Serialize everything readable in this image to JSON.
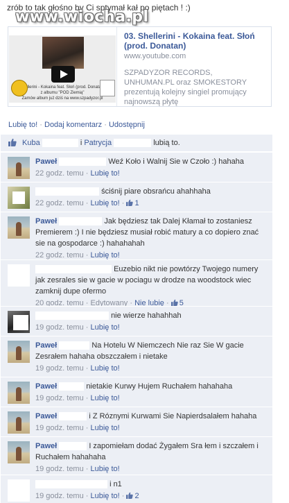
{
  "post": {
    "text": "zrób to tak głośno by Ci sptymał kał po piętach ! :)",
    "watermark": "www.wiocha.pl"
  },
  "attachment": {
    "title": "03. Shellerini - Kokaina feat. Słoń (prod. Donatan)",
    "url": "www.youtube.com",
    "description": "SZPADYZOR RECORDS, UNHUMAN.PL oraz SMOKESTORY prezentują kolejny singiel promujący najnowszą płytę",
    "thumb_caption_1": "Shellerini - Kokaina feat. Słoń (prod. Donatan)",
    "thumb_caption_2": "z albumu \"POD Ziemią\"",
    "thumb_caption_3": "Zamów album już dziś na www.szpadyzor.pl"
  },
  "actions": {
    "like": "Lubię to!",
    "comment": "Dodaj komentarz",
    "share": "Udostępnij",
    "separator": "·"
  },
  "likes": {
    "name1": "Kuba",
    "conj": "i",
    "name2": "Patrycja",
    "suffix": "lubią to."
  },
  "comments": [
    {
      "author": "Paweł",
      "text": "Weź Koło i Walnij Sie w Czoło :) hahaha",
      "time": "22 godz. temu",
      "like": "Lubię to!",
      "likes": ""
    },
    {
      "author": "",
      "text": "ściśnij piare obsrańcu ahahhaha",
      "time": "22 godz. temu",
      "like": "Lubię to!",
      "likes": "1"
    },
    {
      "author": "Paweł",
      "text": "Jak będziesz tak Dalej Kłamał to zostaniesz Premierem :) I nie będziesz musiał robić matury a co dopiero znać sie na gospodarce :) hahahahah",
      "time": "22 godz. temu",
      "like": "Lubię to!",
      "likes": ""
    },
    {
      "author": "",
      "text": "Euzebio nikt nie powtórzy Twojego numery jak zesrales sie w gacie w pociagu w drodze na woodstock wiec zamknij dupe ofermo",
      "time": "20 godz. temu",
      "edited": "Edytowany",
      "like": "Nie lubię",
      "likes": "5"
    },
    {
      "author": "",
      "text": "nie wierze hahahhah",
      "time": "19 godz. temu",
      "like": "Lubię to!",
      "likes": ""
    },
    {
      "author": "Paweł",
      "text": "Na Hotelu W Niemczech Nie raz Sie W gacie Zesrałem hahaha obszczałem i nietake",
      "time": "19 godz. temu",
      "like": "Lubię to!",
      "likes": ""
    },
    {
      "author": "Paweł",
      "text": "nietakie Kurwy Hujem Ruchałem hahahaha",
      "time": "19 godz. temu",
      "like": "Lubię to!",
      "likes": ""
    },
    {
      "author": "Paweł",
      "text": "i Z Róznymi Kurwami Sie Napierdsalałem hahaha",
      "time": "19 godz. temu",
      "like": "Lubię to!",
      "likes": ""
    },
    {
      "author": "Paweł",
      "text": "I zapomiełam dodać Żygałem Sra łem i szczałem i Ruchałem hahahaha",
      "time": "19 godz. temu",
      "like": "Lubię to!",
      "likes": ""
    },
    {
      "author": "",
      "text": "i n1",
      "time": "19 godz. temu",
      "like": "Lubię to!",
      "likes": "2"
    }
  ]
}
